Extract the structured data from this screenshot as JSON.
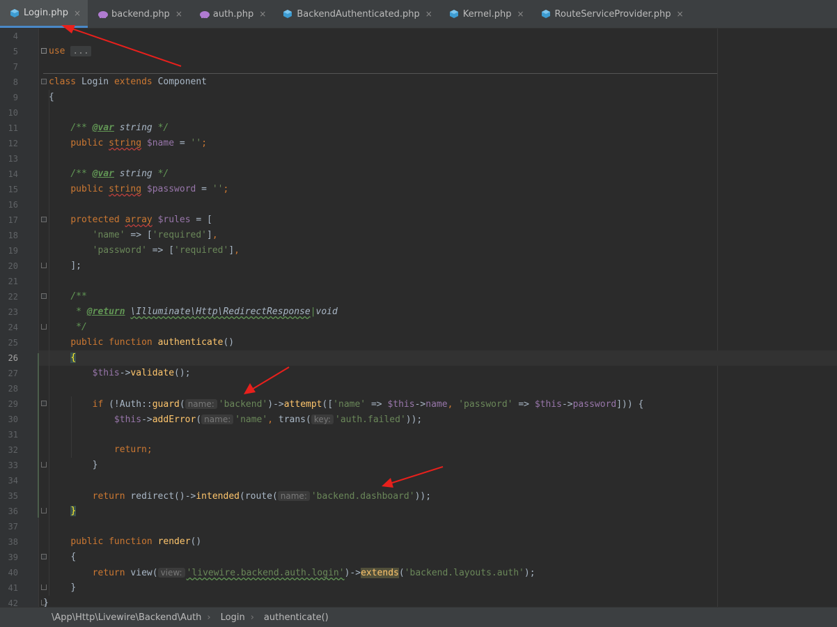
{
  "tabs": [
    {
      "label": "Login.php",
      "icon": "php-class-icon",
      "color": "#3d9cd2",
      "active": true
    },
    {
      "label": "backend.php",
      "icon": "php-elephant-icon",
      "color": "#b07bd1",
      "active": false
    },
    {
      "label": "auth.php",
      "icon": "php-elephant-icon",
      "color": "#b07bd1",
      "active": false
    },
    {
      "label": "BackendAuthenticated.php",
      "icon": "php-class-icon",
      "color": "#3d9cd2",
      "active": false
    },
    {
      "label": "Kernel.php",
      "icon": "php-class-icon",
      "color": "#3d9cd2",
      "active": false
    },
    {
      "label": "RouteServiceProvider.php",
      "icon": "php-class-icon",
      "color": "#3d9cd2",
      "active": false
    }
  ],
  "tab_close_glyph": "×",
  "line_numbers": [
    "4",
    "5",
    "7",
    "8",
    "9",
    "10",
    "11",
    "12",
    "13",
    "14",
    "15",
    "16",
    "17",
    "18",
    "19",
    "20",
    "21",
    "22",
    "23",
    "24",
    "25",
    "26",
    "27",
    "28",
    "29",
    "30",
    "31",
    "32",
    "33",
    "34",
    "35",
    "36",
    "37",
    "38",
    "39",
    "40",
    "41",
    "42"
  ],
  "current_line": "26",
  "code": {
    "use_kw": "use",
    "use_collapsed": "...",
    "class_kw": "class",
    "class_name": "Login",
    "extends_kw": "extends",
    "parent": "Component",
    "open_brace": "{",
    "close_brace": "}",
    "doc_var_open": "/** ",
    "doc_var_tag": "@var",
    "doc_var_type": " string ",
    "doc_var_close": "*/",
    "public_kw": "public",
    "protected_kw": "protected",
    "string_type": "string",
    "array_type": "array",
    "name_var": "$name",
    "password_var": "$password",
    "rules_var": "$rules",
    "assign_empty": " = ",
    "empty_str": "''",
    "semicolon": ";",
    "assign_open": " = [",
    "rule_name_key": "'name'",
    "rule_password_key": "'password'",
    "arrow_op": " => ",
    "rule_required": "'required'",
    "close_array": "];",
    "doc_open": "/**",
    "doc_star": " * ",
    "doc_return_tag": "@return",
    "doc_return_type": "\\Illuminate\\Http\\RedirectResponse",
    "doc_pipe": "|",
    "doc_void": "void",
    "doc_close": " */",
    "function_kw": "function",
    "authenticate_fn": "authenticate",
    "render_fn": "render",
    "parens": "()",
    "this_var": "$this",
    "obj_op": "->",
    "validate_fn": "validate",
    "call_end": "();",
    "if_kw": "if",
    "if_open": " (!Auth::",
    "guard_fn": "guard",
    "hint_name": "name:",
    "str_backend": "'backend'",
    "attempt_fn": "attempt",
    "attempt_open": "([",
    "str_name": "'name'",
    "str_password": "'password'",
    "name_prop": "name",
    "password_prop": "password",
    "attempt_close": "])) {",
    "add_error_fn": "addError",
    "trans_fn": "trans",
    "hint_key": "key:",
    "str_auth_failed": "'auth.failed'",
    "add_error_close": "));",
    "return_kw": "return",
    "redirect_fn": "redirect",
    "intended_fn": "intended",
    "route_fn": "route",
    "str_dashboard": "'backend.dashboard'",
    "redirect_close": "));",
    "view_fn": "view",
    "hint_view": "view:",
    "str_view": "'livewire.backend.auth.login'",
    "extends_fn": "extends",
    "str_layout": "'backend.layouts.auth'",
    "view_close": ");"
  },
  "breadcrumb": [
    "\\App\\Http\\Livewire\\Backend\\Auth",
    "Login",
    "authenticate()"
  ],
  "breadcrumb_sep": "›",
  "annotation_color": "#e8201c"
}
